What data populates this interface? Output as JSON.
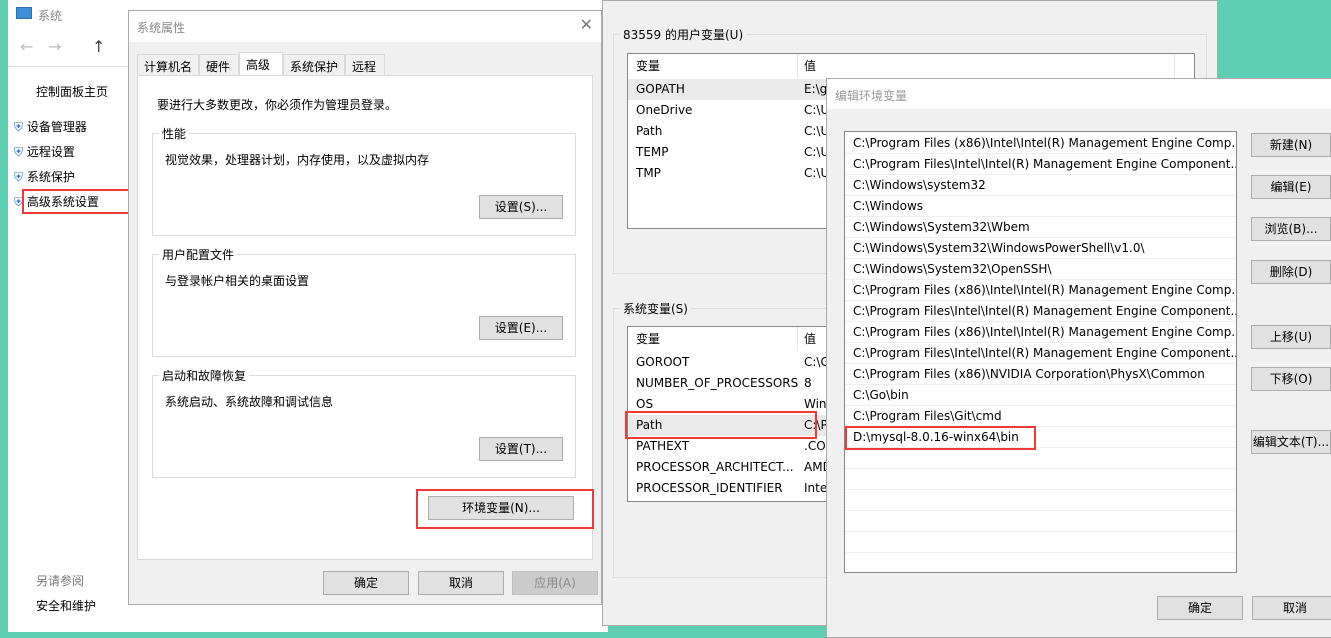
{
  "system_window": {
    "title": "系统",
    "sidebar": {
      "home": "控制面板主页",
      "items": [
        "设备管理器",
        "远程设置",
        "系统保护",
        "高级系统设置"
      ],
      "see_also": "另请参阅",
      "security": "安全和维护"
    }
  },
  "sysprops": {
    "title": "系统属性",
    "tabs": [
      "计算机名",
      "硬件",
      "高级",
      "系统保护",
      "远程"
    ],
    "active_tab": "高级",
    "admin_note": "要进行大多数更改，你必须作为管理员登录。",
    "groups": [
      {
        "title": "性能",
        "desc": "视觉效果，处理器计划，内存使用，以及虚拟内存",
        "button": "设置(S)..."
      },
      {
        "title": "用户配置文件",
        "desc": "与登录帐户相关的桌面设置",
        "button": "设置(E)..."
      },
      {
        "title": "启动和故障恢复",
        "desc": "系统启动、系统故障和调试信息",
        "button": "设置(T)..."
      }
    ],
    "env_button": "环境变量(N)...",
    "ok": "确定",
    "cancel": "取消",
    "apply": "应用(A)"
  },
  "envvars": {
    "user_title": "83559 的用户变量(U)",
    "col_var": "变量",
    "col_val": "值",
    "user_rows": [
      [
        "GOPATH",
        "E:\\g"
      ],
      [
        "OneDrive",
        "C:\\U"
      ],
      [
        "Path",
        "C:\\U"
      ],
      [
        "TEMP",
        "C:\\U"
      ],
      [
        "TMP",
        "C:\\U"
      ]
    ],
    "sys_title": "系统变量(S)",
    "sys_rows": [
      [
        "GOROOT",
        "C:\\G"
      ],
      [
        "NUMBER_OF_PROCESSORS",
        "8"
      ],
      [
        "OS",
        "Win"
      ],
      [
        "Path",
        "C:\\P"
      ],
      [
        "PATHEXT",
        ".CO"
      ],
      [
        "PROCESSOR_ARCHITECT...",
        "AMD"
      ],
      [
        "PROCESSOR_IDENTIFIER",
        "Inte"
      ]
    ]
  },
  "edit": {
    "title": "编辑环境变量",
    "paths": [
      "C:\\Program Files (x86)\\Intel\\Intel(R) Management Engine Comp...",
      "C:\\Program Files\\Intel\\Intel(R) Management Engine Component...",
      "C:\\Windows\\system32",
      "C:\\Windows",
      "C:\\Windows\\System32\\Wbem",
      "C:\\Windows\\System32\\WindowsPowerShell\\v1.0\\",
      "C:\\Windows\\System32\\OpenSSH\\",
      "C:\\Program Files (x86)\\Intel\\Intel(R) Management Engine Comp...",
      "C:\\Program Files\\Intel\\Intel(R) Management Engine Component...",
      "C:\\Program Files (x86)\\Intel\\Intel(R) Management Engine Comp...",
      "C:\\Program Files\\Intel\\Intel(R) Management Engine Component...",
      "C:\\Program Files (x86)\\NVIDIA Corporation\\PhysX\\Common",
      "C:\\Go\\bin",
      "C:\\Program Files\\Git\\cmd",
      "D:\\mysql-8.0.16-winx64\\bin"
    ],
    "buttons": [
      "新建(N)",
      "编辑(E)",
      "浏览(B)...",
      "删除(D)",
      "上移(U)",
      "下移(O)",
      "编辑文本(T)..."
    ],
    "ok": "确定",
    "cancel": "取消"
  },
  "colors": {
    "highlight": "#f03a3a",
    "background": "#5ecfb2",
    "dialog": "#f0f0f0"
  }
}
